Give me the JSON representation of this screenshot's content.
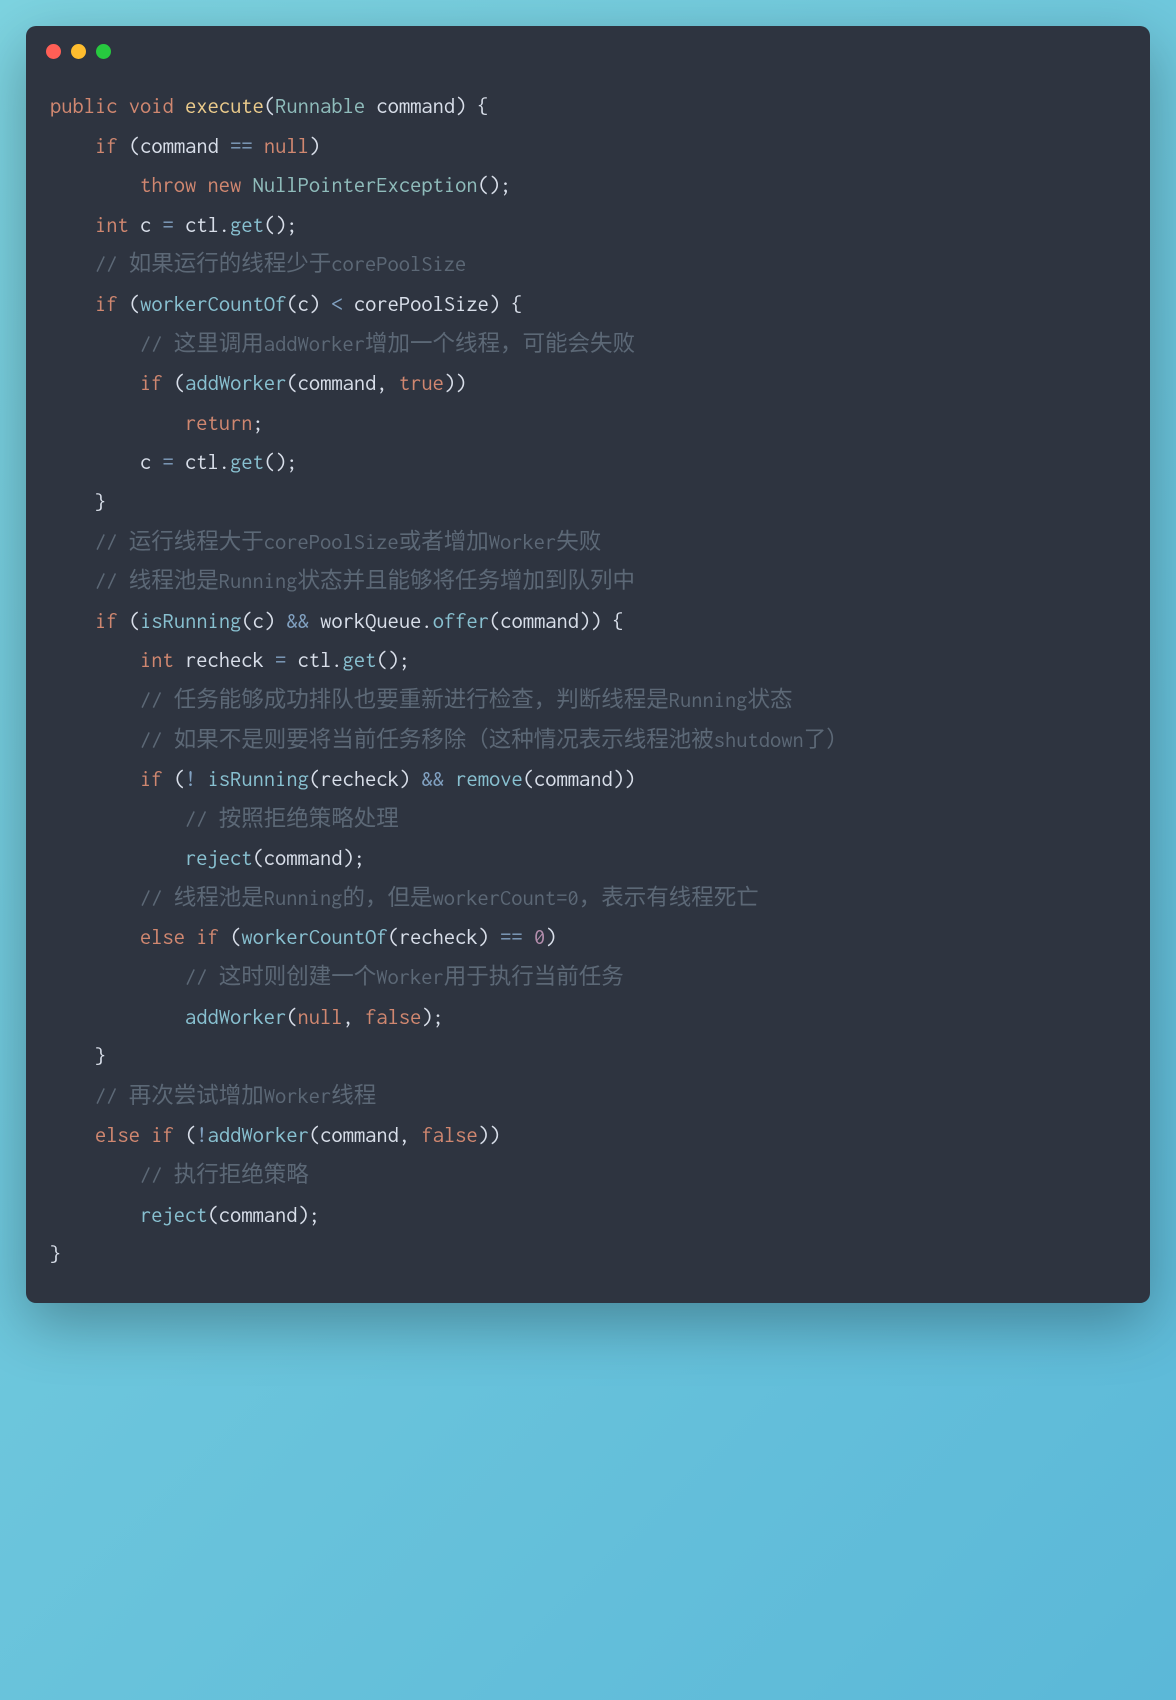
{
  "window": {
    "traffic_lights": [
      "red",
      "yellow",
      "green"
    ]
  },
  "code": {
    "language": "java",
    "lines": [
      {
        "tokens": [
          {
            "t": "kw",
            "v": "public"
          },
          {
            "t": "ident",
            "v": " "
          },
          {
            "t": "kw",
            "v": "void"
          },
          {
            "t": "ident",
            "v": " "
          },
          {
            "t": "fn",
            "v": "execute"
          },
          {
            "t": "punc",
            "v": "("
          },
          {
            "t": "type",
            "v": "Runnable"
          },
          {
            "t": "ident",
            "v": " command"
          },
          {
            "t": "punc",
            "v": ")"
          },
          {
            "t": "ident",
            "v": " "
          },
          {
            "t": "punc",
            "v": "{"
          }
        ]
      },
      {
        "indent": 4,
        "tokens": [
          {
            "t": "kw",
            "v": "if"
          },
          {
            "t": "ident",
            "v": " "
          },
          {
            "t": "punc",
            "v": "("
          },
          {
            "t": "ident",
            "v": "command "
          },
          {
            "t": "op",
            "v": "=="
          },
          {
            "t": "ident",
            "v": " "
          },
          {
            "t": "kw",
            "v": "null"
          },
          {
            "t": "punc",
            "v": ")"
          }
        ]
      },
      {
        "indent": 8,
        "tokens": [
          {
            "t": "kw",
            "v": "throw"
          },
          {
            "t": "ident",
            "v": " "
          },
          {
            "t": "kw",
            "v": "new"
          },
          {
            "t": "ident",
            "v": " "
          },
          {
            "t": "type",
            "v": "NullPointerException"
          },
          {
            "t": "punc",
            "v": "();"
          }
        ]
      },
      {
        "indent": 4,
        "tokens": [
          {
            "t": "kw",
            "v": "int"
          },
          {
            "t": "ident",
            "v": " c "
          },
          {
            "t": "op",
            "v": "="
          },
          {
            "t": "ident",
            "v": " ctl"
          },
          {
            "t": "punc",
            "v": "."
          },
          {
            "t": "call",
            "v": "get"
          },
          {
            "t": "punc",
            "v": "();"
          }
        ]
      },
      {
        "indent": 4,
        "tokens": [
          {
            "t": "comment",
            "v": "// 如果运行的线程少于corePoolSize"
          }
        ]
      },
      {
        "indent": 4,
        "tokens": [
          {
            "t": "kw",
            "v": "if"
          },
          {
            "t": "ident",
            "v": " "
          },
          {
            "t": "punc",
            "v": "("
          },
          {
            "t": "call",
            "v": "workerCountOf"
          },
          {
            "t": "punc",
            "v": "("
          },
          {
            "t": "ident",
            "v": "c"
          },
          {
            "t": "punc",
            "v": ")"
          },
          {
            "t": "ident",
            "v": " "
          },
          {
            "t": "op",
            "v": "<"
          },
          {
            "t": "ident",
            "v": " corePoolSize"
          },
          {
            "t": "punc",
            "v": ")"
          },
          {
            "t": "ident",
            "v": " "
          },
          {
            "t": "punc",
            "v": "{"
          }
        ]
      },
      {
        "indent": 8,
        "tokens": [
          {
            "t": "comment",
            "v": "// 这里调用addWorker增加一个线程，可能会失败"
          }
        ]
      },
      {
        "indent": 8,
        "tokens": [
          {
            "t": "kw",
            "v": "if"
          },
          {
            "t": "ident",
            "v": " "
          },
          {
            "t": "punc",
            "v": "("
          },
          {
            "t": "call",
            "v": "addWorker"
          },
          {
            "t": "punc",
            "v": "("
          },
          {
            "t": "ident",
            "v": "command"
          },
          {
            "t": "punc",
            "v": ","
          },
          {
            "t": "ident",
            "v": " "
          },
          {
            "t": "kw",
            "v": "true"
          },
          {
            "t": "punc",
            "v": "))"
          }
        ]
      },
      {
        "indent": 12,
        "tokens": [
          {
            "t": "kw",
            "v": "return"
          },
          {
            "t": "punc",
            "v": ";"
          }
        ]
      },
      {
        "indent": 8,
        "tokens": [
          {
            "t": "ident",
            "v": "c "
          },
          {
            "t": "op",
            "v": "="
          },
          {
            "t": "ident",
            "v": " ctl"
          },
          {
            "t": "punc",
            "v": "."
          },
          {
            "t": "call",
            "v": "get"
          },
          {
            "t": "punc",
            "v": "();"
          }
        ]
      },
      {
        "indent": 4,
        "tokens": [
          {
            "t": "punc",
            "v": "}"
          }
        ]
      },
      {
        "indent": 4,
        "tokens": [
          {
            "t": "comment",
            "v": "// 运行线程大于corePoolSize或者增加Worker失败"
          }
        ]
      },
      {
        "indent": 4,
        "tokens": [
          {
            "t": "comment",
            "v": "// 线程池是Running状态并且能够将任务增加到队列中"
          }
        ]
      },
      {
        "indent": 4,
        "tokens": [
          {
            "t": "kw",
            "v": "if"
          },
          {
            "t": "ident",
            "v": " "
          },
          {
            "t": "punc",
            "v": "("
          },
          {
            "t": "call",
            "v": "isRunning"
          },
          {
            "t": "punc",
            "v": "("
          },
          {
            "t": "ident",
            "v": "c"
          },
          {
            "t": "punc",
            "v": ")"
          },
          {
            "t": "ident",
            "v": " "
          },
          {
            "t": "op",
            "v": "&&"
          },
          {
            "t": "ident",
            "v": " workQueue"
          },
          {
            "t": "punc",
            "v": "."
          },
          {
            "t": "call",
            "v": "offer"
          },
          {
            "t": "punc",
            "v": "("
          },
          {
            "t": "ident",
            "v": "command"
          },
          {
            "t": "punc",
            "v": "))"
          },
          {
            "t": "ident",
            "v": " "
          },
          {
            "t": "punc",
            "v": "{"
          }
        ]
      },
      {
        "indent": 8,
        "tokens": [
          {
            "t": "kw",
            "v": "int"
          },
          {
            "t": "ident",
            "v": " recheck "
          },
          {
            "t": "op",
            "v": "="
          },
          {
            "t": "ident",
            "v": " ctl"
          },
          {
            "t": "punc",
            "v": "."
          },
          {
            "t": "call",
            "v": "get"
          },
          {
            "t": "punc",
            "v": "();"
          }
        ]
      },
      {
        "indent": 8,
        "tokens": [
          {
            "t": "comment",
            "v": "// 任务能够成功排队也要重新进行检查，判断线程是Running状态"
          }
        ]
      },
      {
        "indent": 8,
        "tokens": [
          {
            "t": "comment",
            "v": "// 如果不是则要将当前任务移除（这种情况表示线程池被shutdown了）"
          }
        ]
      },
      {
        "indent": 8,
        "tokens": [
          {
            "t": "kw",
            "v": "if"
          },
          {
            "t": "ident",
            "v": " "
          },
          {
            "t": "punc",
            "v": "("
          },
          {
            "t": "op",
            "v": "!"
          },
          {
            "t": "ident",
            "v": " "
          },
          {
            "t": "call",
            "v": "isRunning"
          },
          {
            "t": "punc",
            "v": "("
          },
          {
            "t": "ident",
            "v": "recheck"
          },
          {
            "t": "punc",
            "v": ")"
          },
          {
            "t": "ident",
            "v": " "
          },
          {
            "t": "op",
            "v": "&&"
          },
          {
            "t": "ident",
            "v": " "
          },
          {
            "t": "call",
            "v": "remove"
          },
          {
            "t": "punc",
            "v": "("
          },
          {
            "t": "ident",
            "v": "command"
          },
          {
            "t": "punc",
            "v": "))"
          }
        ]
      },
      {
        "indent": 12,
        "tokens": [
          {
            "t": "comment",
            "v": "// 按照拒绝策略处理"
          }
        ]
      },
      {
        "indent": 12,
        "tokens": [
          {
            "t": "call",
            "v": "reject"
          },
          {
            "t": "punc",
            "v": "("
          },
          {
            "t": "ident",
            "v": "command"
          },
          {
            "t": "punc",
            "v": ");"
          }
        ]
      },
      {
        "indent": 8,
        "tokens": [
          {
            "t": "comment",
            "v": "// 线程池是Running的，但是workerCount=0，表示有线程死亡"
          }
        ]
      },
      {
        "indent": 8,
        "tokens": [
          {
            "t": "kw",
            "v": "else"
          },
          {
            "t": "ident",
            "v": " "
          },
          {
            "t": "kw",
            "v": "if"
          },
          {
            "t": "ident",
            "v": " "
          },
          {
            "t": "punc",
            "v": "("
          },
          {
            "t": "call",
            "v": "workerCountOf"
          },
          {
            "t": "punc",
            "v": "("
          },
          {
            "t": "ident",
            "v": "recheck"
          },
          {
            "t": "punc",
            "v": ")"
          },
          {
            "t": "ident",
            "v": " "
          },
          {
            "t": "op",
            "v": "=="
          },
          {
            "t": "ident",
            "v": " "
          },
          {
            "t": "num",
            "v": "0"
          },
          {
            "t": "punc",
            "v": ")"
          }
        ]
      },
      {
        "indent": 12,
        "tokens": [
          {
            "t": "comment",
            "v": "// 这时则创建一个Worker用于执行当前任务"
          }
        ]
      },
      {
        "indent": 12,
        "tokens": [
          {
            "t": "call",
            "v": "addWorker"
          },
          {
            "t": "punc",
            "v": "("
          },
          {
            "t": "kw",
            "v": "null"
          },
          {
            "t": "punc",
            "v": ","
          },
          {
            "t": "ident",
            "v": " "
          },
          {
            "t": "kw",
            "v": "false"
          },
          {
            "t": "punc",
            "v": ");"
          }
        ]
      },
      {
        "indent": 4,
        "tokens": [
          {
            "t": "punc",
            "v": "}"
          }
        ]
      },
      {
        "indent": 4,
        "tokens": [
          {
            "t": "comment",
            "v": "// 再次尝试增加Worker线程"
          }
        ]
      },
      {
        "indent": 4,
        "tokens": [
          {
            "t": "kw",
            "v": "else"
          },
          {
            "t": "ident",
            "v": " "
          },
          {
            "t": "kw",
            "v": "if"
          },
          {
            "t": "ident",
            "v": " "
          },
          {
            "t": "punc",
            "v": "("
          },
          {
            "t": "op",
            "v": "!"
          },
          {
            "t": "call",
            "v": "addWorker"
          },
          {
            "t": "punc",
            "v": "("
          },
          {
            "t": "ident",
            "v": "command"
          },
          {
            "t": "punc",
            "v": ","
          },
          {
            "t": "ident",
            "v": " "
          },
          {
            "t": "kw",
            "v": "false"
          },
          {
            "t": "punc",
            "v": "))"
          }
        ]
      },
      {
        "indent": 8,
        "tokens": [
          {
            "t": "comment",
            "v": "// 执行拒绝策略"
          }
        ]
      },
      {
        "indent": 8,
        "tokens": [
          {
            "t": "call",
            "v": "reject"
          },
          {
            "t": "punc",
            "v": "("
          },
          {
            "t": "ident",
            "v": "command"
          },
          {
            "t": "punc",
            "v": ");"
          }
        ]
      },
      {
        "tokens": [
          {
            "t": "punc",
            "v": "}"
          }
        ]
      }
    ]
  }
}
